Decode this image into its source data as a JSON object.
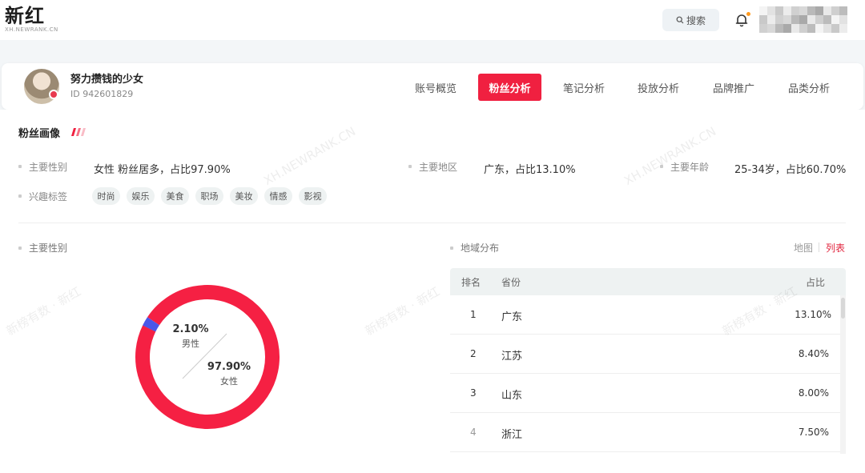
{
  "brand": {
    "logo": "新红",
    "logo_sub": "XH.NEWRANK.CN"
  },
  "topbar": {
    "search_label": "搜索",
    "search_icon": "search-icon",
    "bell_icon": "bell-icon"
  },
  "account": {
    "name": "努力攒钱的少女",
    "id": "ID 942601829"
  },
  "nav": [
    "账号概览",
    "粉丝分析",
    "笔记分析",
    "投放分析",
    "品牌推广",
    "品类分析"
  ],
  "nav_active": "粉丝分析",
  "profile": {
    "title": "粉丝画像",
    "gender_label": "主要性别",
    "gender_value": "女性 粉丝居多，占比97.90%",
    "region_label": "主要地区",
    "region_value": "广东，占比13.10%",
    "age_label": "主要年龄",
    "age_value": "25-34岁，占比60.70%",
    "interest_label": "兴趣标签",
    "tags": [
      "时尚",
      "娱乐",
      "美食",
      "职场",
      "美妆",
      "情感",
      "影视"
    ]
  },
  "gender_chart": {
    "title": "主要性别",
    "male": {
      "label": "男性",
      "pct": "2.10%",
      "value": 2.1
    },
    "female": {
      "label": "女性",
      "pct": "97.90%",
      "value": 97.9
    },
    "colors": {
      "female": "#f52043",
      "male": "#4a57e8"
    }
  },
  "region": {
    "title": "地域分布",
    "toggle_map": "地图",
    "toggle_list": "列表",
    "columns": {
      "rank": "排名",
      "province": "省份",
      "share": "占比"
    },
    "rows": [
      {
        "rank": "1",
        "province": "广东",
        "share": "13.10%"
      },
      {
        "rank": "2",
        "province": "江苏",
        "share": "8.40%"
      },
      {
        "rank": "3",
        "province": "山东",
        "share": "8.00%"
      },
      {
        "rank": "4",
        "province": "浙江",
        "share": "7.50%"
      }
    ]
  },
  "watermarks": [
    "XH.NEWRANK.CN",
    "新榜有数 · 新红"
  ]
}
